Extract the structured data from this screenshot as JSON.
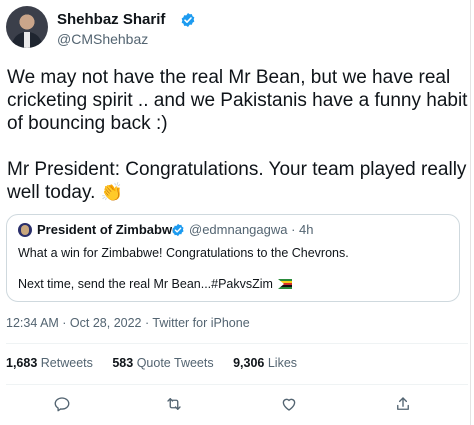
{
  "author": {
    "name": "Shehbaz Sharif",
    "handle": "@CMShehbaz",
    "verified": true,
    "avatar_icon": "profile-photo"
  },
  "tweet": {
    "paragraph1": "We may not have the real Mr Bean, but we have real cricketing spirit .. and we Pakistanis have a funny habit of bouncing back :)",
    "paragraph2": "Mr President: Congratulations. Your team played really well today.",
    "emoji": "👏"
  },
  "quote": {
    "name": "President of Zimbabwe",
    "handle_time": "@edmnangagwa · 4h",
    "line1": "What a win for Zimbabwe! Congratulations to the Chevrons.",
    "line2": "Next time, send the real Mr Bean...#PakvsZim",
    "flag_icon": "zimbabwe-flag"
  },
  "meta": {
    "timestamp": "12:34 AM · Oct 28, 2022 · Twitter for iPhone"
  },
  "stats": {
    "retweets_count": "1,683",
    "retweets_label": "Retweets",
    "quotes_count": "583",
    "quotes_label": "Quote Tweets",
    "likes_count": "9,306",
    "likes_label": "Likes"
  },
  "actions": [
    "reply-icon",
    "retweet-icon",
    "like-icon",
    "share-icon"
  ],
  "colors": {
    "verified": "#1d9bf0",
    "text_primary": "#0f1419",
    "text_secondary": "#536471",
    "border": "#cfd9de"
  }
}
